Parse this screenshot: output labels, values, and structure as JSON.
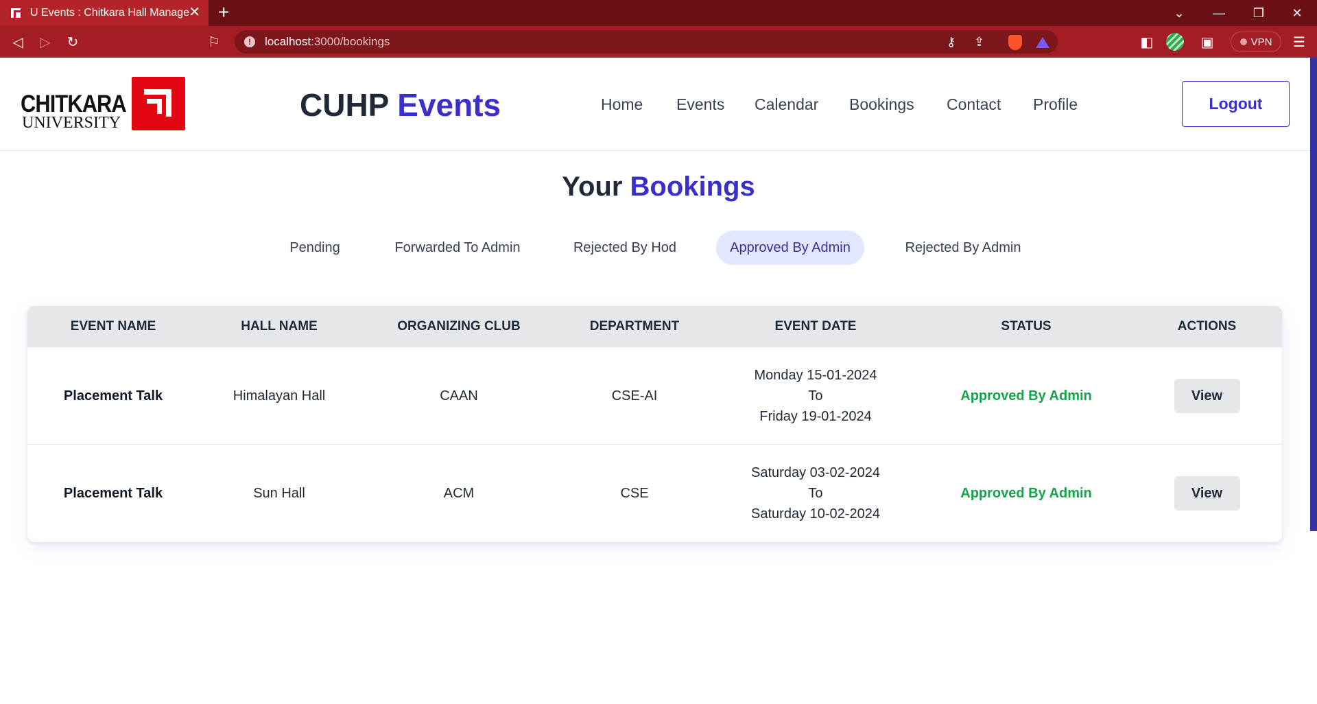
{
  "browser": {
    "tab_title": "U Events : Chitkara Hall Management",
    "url_host": "localhost",
    "url_path": ":3000/bookings",
    "vpn_label": "VPN"
  },
  "navbar": {
    "logo_word": "CHITKARA",
    "logo_sub": "UNIVERSITY",
    "brand_prefix": "CUHP",
    "brand_accent": "Events",
    "links": [
      "Home",
      "Events",
      "Calendar",
      "Bookings",
      "Contact",
      "Profile"
    ],
    "logout_label": "Logout"
  },
  "page": {
    "heading_prefix": "Your",
    "heading_accent": "Bookings",
    "filters": [
      "Pending",
      "Forwarded To Admin",
      "Rejected By Hod",
      "Approved By Admin",
      "Rejected By Admin"
    ],
    "active_filter": "Approved By Admin"
  },
  "table": {
    "headers": [
      "Event Name",
      "Hall Name",
      "Organizing Club",
      "Department",
      "Event Date",
      "Status",
      "Actions"
    ],
    "rows": [
      {
        "event_name": "Placement Talk",
        "hall_name": "Himalayan Hall",
        "club": "CAAN",
        "department": "CSE-AI",
        "date_from": "Monday 15-01-2024",
        "date_sep": "To",
        "date_to": "Friday 19-01-2024",
        "status": "Approved By Admin",
        "action": "View"
      },
      {
        "event_name": "Placement Talk",
        "hall_name": "Sun Hall",
        "club": "ACM",
        "department": "CSE",
        "date_from": "Saturday 03-02-2024",
        "date_sep": "To",
        "date_to": "Saturday 10-02-2024",
        "status": "Approved By Admin",
        "action": "View"
      }
    ]
  },
  "colors": {
    "accent": "#3b2fc9",
    "status_approved": "#16a34a",
    "chrome_tabbar": "#6b1014",
    "chrome_toolbar": "#a51d24"
  }
}
